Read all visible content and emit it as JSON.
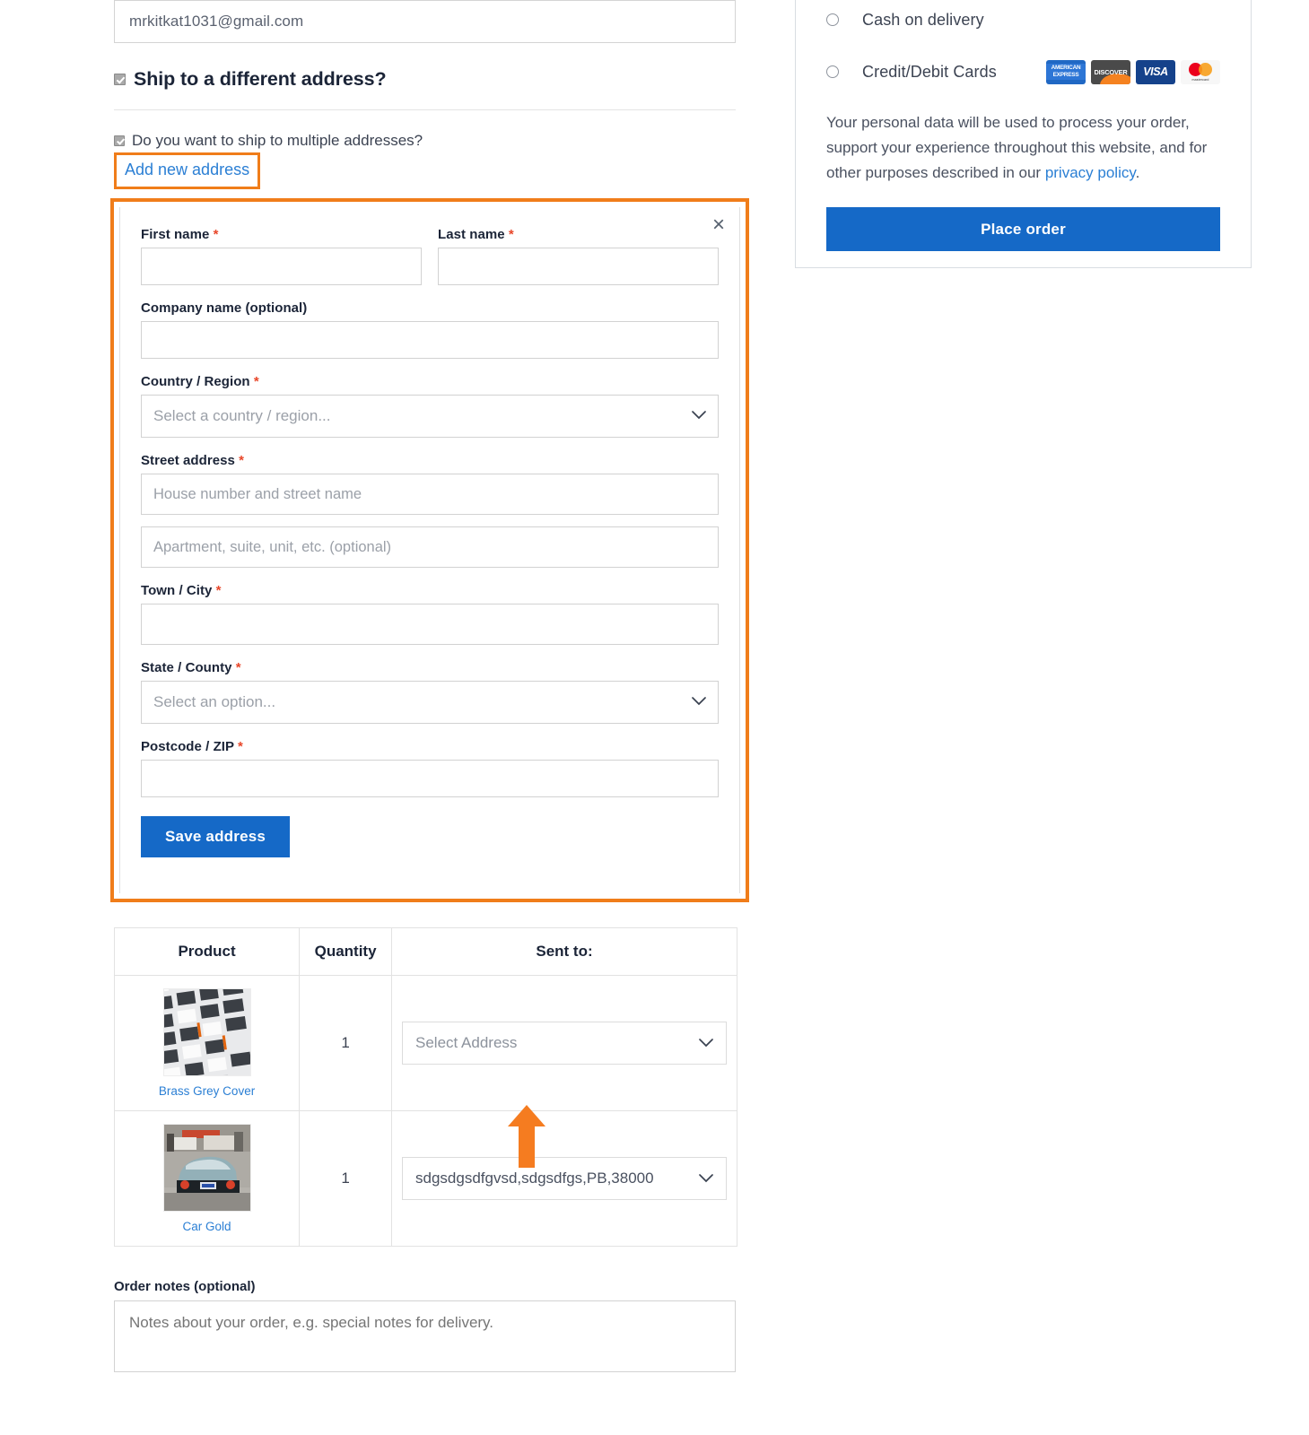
{
  "checkout": {
    "email_value": "mrkitkat1031@gmail.com",
    "ship_different_label": "Ship to a different address?",
    "multi_address_label": "Do you want to ship to multiple addresses?",
    "add_new_address_label": "Add new address"
  },
  "address_form": {
    "close_icon": "×",
    "first_name": {
      "label": "First name",
      "required": "*",
      "value": ""
    },
    "last_name": {
      "label": "Last name",
      "required": "*",
      "value": ""
    },
    "company": {
      "label": "Company name (optional)",
      "value": ""
    },
    "country": {
      "label": "Country / Region",
      "required": "*",
      "value": "Select a country / region..."
    },
    "street": {
      "label": "Street address",
      "required": "*",
      "line1_placeholder": "House number and street name",
      "line2_placeholder": "Apartment, suite, unit, etc. (optional)"
    },
    "city": {
      "label": "Town / City",
      "required": "*",
      "value": ""
    },
    "state": {
      "label": "State / County",
      "required": "*",
      "value": "Select an option..."
    },
    "postcode": {
      "label": "Postcode / ZIP",
      "required": "*",
      "value": ""
    },
    "save_label": "Save address"
  },
  "products_table": {
    "headers": [
      "Product",
      "Quantity",
      "Sent to:"
    ],
    "rows": [
      {
        "name": "Brass Grey Cover",
        "quantity": "1",
        "address_value": "Select Address",
        "address_is_placeholder": true
      },
      {
        "name": "Car Gold",
        "quantity": "1",
        "address_value": "sdgsdgsdfgvsd,sdgsdfgs,PB,38000",
        "address_is_placeholder": false
      }
    ]
  },
  "order_notes": {
    "label": "Order notes (optional)",
    "placeholder": "Notes about your order, e.g. special notes for delivery.",
    "value": ""
  },
  "payment": {
    "methods": [
      {
        "label": "Cash on delivery",
        "selected": false
      },
      {
        "label": "Credit/Debit Cards",
        "selected": false
      }
    ],
    "card_logos": [
      "AMERICAN EXPRESS",
      "DISCOVER",
      "VISA",
      "mastercard"
    ],
    "privacy_text_before": "Your personal data will be used to process your order, support your experience throughout this website, and for other purposes described in our ",
    "privacy_link": "privacy policy",
    "privacy_text_after": ".",
    "place_order_label": "Place order"
  },
  "colors": {
    "accent_blue": "#1569c7",
    "link_blue": "#2b7fd4",
    "highlight_orange": "#f07d1a",
    "required_red": "#e8472a"
  }
}
